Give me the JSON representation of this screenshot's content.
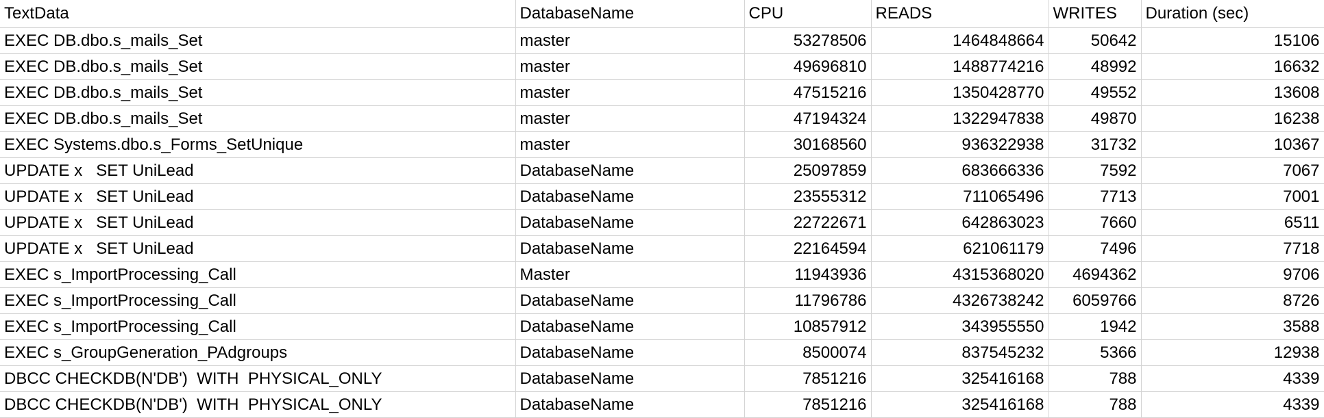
{
  "sheet": {
    "headers": [
      "TextData",
      "DatabaseName",
      "CPU",
      "READS",
      "WRITES",
      "Duration (sec)"
    ],
    "rows": [
      [
        "EXEC DB.dbo.s_mails_Set",
        "master",
        "53278506",
        "1464848664",
        "50642",
        "15106"
      ],
      [
        "EXEC DB.dbo.s_mails_Set",
        "master",
        "49696810",
        "1488774216",
        "48992",
        "16632"
      ],
      [
        "EXEC DB.dbo.s_mails_Set",
        "master",
        "47515216",
        "1350428770",
        "49552",
        "13608"
      ],
      [
        "EXEC DB.dbo.s_mails_Set",
        "master",
        "47194324",
        "1322947838",
        "49870",
        "16238"
      ],
      [
        "EXEC Systems.dbo.s_Forms_SetUnique",
        "master",
        "30168560",
        "936322938",
        "31732",
        "10367"
      ],
      [
        "UPDATE x   SET UniLead",
        "DatabaseName",
        "25097859",
        "683666336",
        "7592",
        "7067"
      ],
      [
        "UPDATE x   SET UniLead",
        "DatabaseName",
        "23555312",
        "711065496",
        "7713",
        "7001"
      ],
      [
        "UPDATE x   SET UniLead",
        "DatabaseName",
        "22722671",
        "642863023",
        "7660",
        "6511"
      ],
      [
        "UPDATE x   SET UniLead",
        "DatabaseName",
        "22164594",
        "621061179",
        "7496",
        "7718"
      ],
      [
        "EXEC s_ImportProcessing_Call",
        "Master",
        "11943936",
        "4315368020",
        "4694362",
        "9706"
      ],
      [
        "EXEC s_ImportProcessing_Call",
        "DatabaseName",
        "11796786",
        "4326738242",
        "6059766",
        "8726"
      ],
      [
        "EXEC s_ImportProcessing_Call",
        "DatabaseName",
        "10857912",
        "343955550",
        "1942",
        "3588"
      ],
      [
        "EXEC s_GroupGeneration_PAdgroups",
        "DatabaseName",
        "8500074",
        "837545232",
        "5366",
        "12938"
      ],
      [
        "DBCC CHECKDB(N'DB')  WITH  PHYSICAL_ONLY",
        "DatabaseName",
        "7851216",
        "325416168",
        "788",
        "4339"
      ],
      [
        "DBCC CHECKDB(N'DB')  WITH  PHYSICAL_ONLY",
        "DatabaseName",
        "7851216",
        "325416168",
        "788",
        "4339"
      ]
    ]
  }
}
